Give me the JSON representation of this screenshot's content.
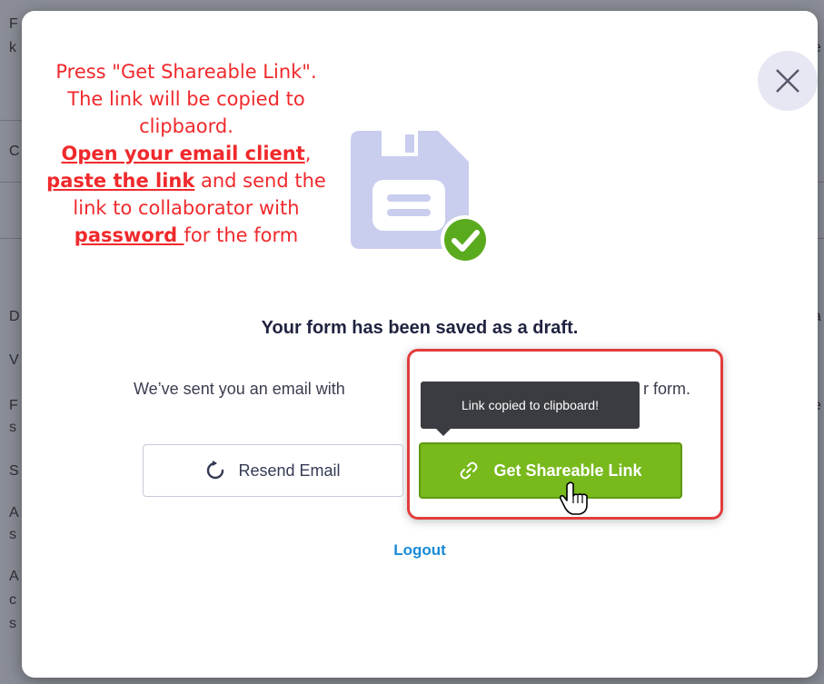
{
  "background": {
    "left_letters": [
      "F",
      "k",
      "C",
      "D",
      "V",
      "F",
      "s",
      "S",
      "A",
      "s",
      "A",
      "c",
      "s"
    ],
    "right_letters": [
      "e",
      "a",
      "e",
      "r",
      "t"
    ]
  },
  "modal": {
    "annotation": {
      "line1": "Press \"Get Shareable Link\". The link will be copied to clipbaord.",
      "link1": "Open your email client",
      "sep1": ",",
      "link2": "paste the link",
      "mid": " and send the link to collaborator with ",
      "link3": "password ",
      "end": "for the form"
    },
    "headline": "Your form has been saved as a draft.",
    "subtext_start": "We’ve sent you an email with",
    "subtext_end": "r form.",
    "tooltip": "Link copied to clipboard!",
    "resend_label": "Resend Email",
    "share_label": "Get Shareable Link",
    "logout_label": "Logout"
  },
  "colors": {
    "accent_green": "#78b91c",
    "annotation_red": "#f0292c",
    "link_blue": "#1a8ad6",
    "illustration_purple": "#c9cdee",
    "check_green": "#5aaa1e"
  },
  "icons": [
    "close-icon",
    "floppy-disk-icon",
    "checkmark-icon",
    "refresh-icon",
    "link-icon",
    "hand-cursor-icon"
  ]
}
